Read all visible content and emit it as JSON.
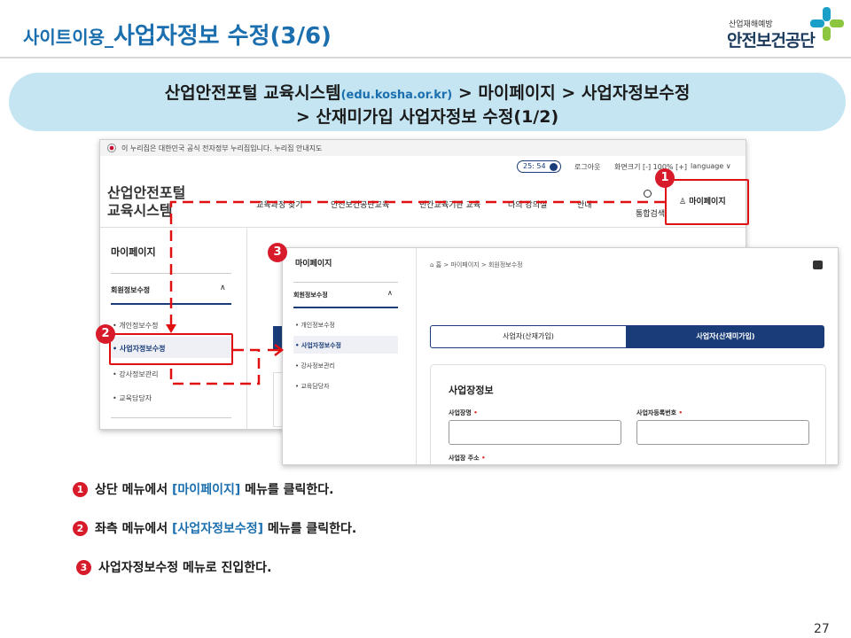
{
  "header": {
    "title_prefix": "사이트이용_",
    "title_main": "사업자정보 수정(3/6)",
    "logo_small": "산업재해예방",
    "logo_big": "안전보건공단",
    "logo_colors": [
      "#1aa0c8",
      "#8cc63f"
    ]
  },
  "banner": {
    "line1_part1": "산업안전포털 교육시스템",
    "line1_url": "(edu.kosha.or.kr)",
    "line1_part2": " > 마이페이지 > 사업자정보수정",
    "line2": "> 산재미가입 사업자정보 수정(1/2)"
  },
  "screenshot1": {
    "gov_notice": "이 누리집은 대한민국 공식 전자정부 누리집입니다.   누리집 안내지도",
    "timer": "25: 54",
    "logout": "로그아웃",
    "font_size": "화면크기 [-] 100% [+]",
    "language": "language ∨",
    "site_logo_line1": "산업안전포털",
    "site_logo_line2": "교육시스템",
    "nav_items": [
      "교육과정 찾기",
      "안전보건공단교육",
      "민간교육기관 교육",
      "나의 강의실",
      "안내"
    ],
    "search_label": "통합검색",
    "mypage_label": "마이페이지",
    "sidebar_title": "마이페이지",
    "sidebar_group": "회원정보수정",
    "sidebar_items": [
      "개인정보수정",
      "사업자정보수정",
      "강사정보관리",
      "교육담당자"
    ]
  },
  "screenshot2": {
    "sidebar_title": "마이페이지",
    "sidebar_group": "회원정보수정",
    "sidebar_items": [
      "• 개인정보수정",
      "• 사업자정보수정",
      "• 강사정보관리",
      "• 교육담당자"
    ],
    "breadcrumb": "⌂  홈  >  마이페이지  >  회원정보수정",
    "tab_a": "사업자(산재가입)",
    "tab_b": "사업자(산재미가입)",
    "card_title": "사업장정보",
    "field1_label": "사업장명",
    "field2_label": "사업자등록번호",
    "field3_label": "사업장 주소",
    "required_mark": "•"
  },
  "badges": [
    "1",
    "2",
    "3"
  ],
  "steps": [
    {
      "num": "1",
      "pre": "상단 메뉴에서 ",
      "highlight": "[마이페이지]",
      "post": " 메뉴를 클릭한다."
    },
    {
      "num": "2",
      "pre": "좌측 메뉴에서 ",
      "highlight": "[사업자정보수정]",
      "post": " 메뉴를 클릭한다."
    },
    {
      "num": "3",
      "pre": "사업자정보수정 메뉴로 진입한다.",
      "highlight": "",
      "post": ""
    }
  ],
  "page_number": "27"
}
